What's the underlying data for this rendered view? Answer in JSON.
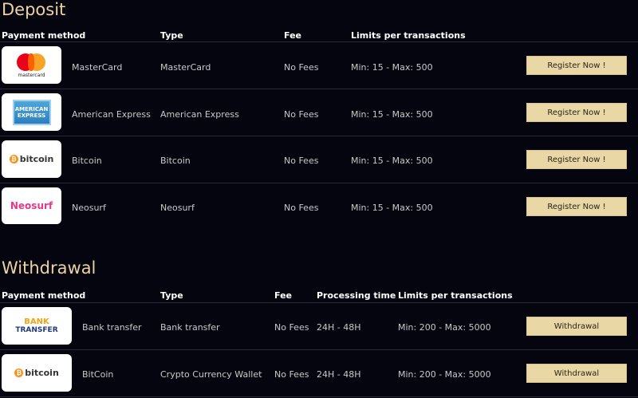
{
  "deposit": {
    "title": "Deposit",
    "headers": {
      "method": "Payment method",
      "type": "Type",
      "fee": "Fee",
      "limits": "Limits per transactions"
    },
    "rows": [
      {
        "logo": "mastercard-logo",
        "logo_text": "mastercard",
        "name": "MasterCard",
        "type": "MasterCard",
        "fee": "No Fees",
        "limits": "Min: 15 - Max: 500",
        "button": "Register Now !"
      },
      {
        "logo": "american-express-logo",
        "logo_text_1": "AMERICAN",
        "logo_text_2": "EXPRESS",
        "name": "American Express",
        "type": "American Express",
        "fee": "No Fees",
        "limits": "Min: 15 - Max: 500",
        "button": "Register Now !"
      },
      {
        "logo": "bitcoin-logo",
        "logo_text": "bitcoin",
        "name": "Bitcoin",
        "type": "Bitcoin",
        "fee": "No Fees",
        "limits": "Min: 15 - Max: 500",
        "button": "Register Now !"
      },
      {
        "logo": "neosurf-logo",
        "logo_text": "Neosurf",
        "name": "Neosurf",
        "type": "Neosurf",
        "fee": "No Fees",
        "limits": "Min: 15 - Max: 500",
        "button": "Register Now !"
      }
    ]
  },
  "withdrawal": {
    "title": "Withdrawal",
    "headers": {
      "method": "Payment method",
      "type": "Type",
      "fee": "Fee",
      "processing": "Processing time",
      "limits": "Limits per transactions"
    },
    "rows": [
      {
        "logo": "bank-transfer-logo",
        "logo_text_1": "BANK",
        "logo_text_2": "TRANSFER",
        "name": "Bank transfer",
        "type": "Bank transfer",
        "fee": "No Fees",
        "processing": "24H - 48H",
        "limits": "Min: 200 - Max: 5000",
        "button": "Withdrawal"
      },
      {
        "logo": "bitcoin-logo",
        "logo_text": "bitcoin",
        "name": "BitCoin",
        "type": "Crypto Currency Wallet",
        "fee": "No Fees",
        "processing": "24H - 48H",
        "limits": "Min: 200 - Max: 5000",
        "button": "Withdrawal"
      }
    ]
  },
  "colors": {
    "background": "#05050f",
    "title": "#ecd3a3",
    "button": "#ead7a6",
    "divider": "#2a2a36"
  }
}
